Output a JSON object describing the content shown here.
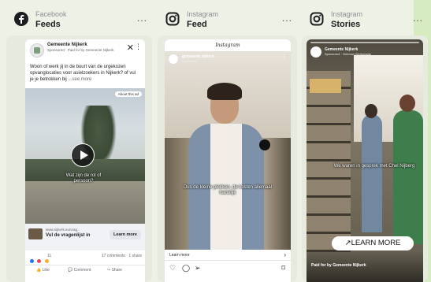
{
  "columns": [
    {
      "platform": "Facebook",
      "placement": "Feeds",
      "more": "...",
      "post": {
        "account": "Gemeente Nijkerk",
        "sponsored": "Sponsored · Paid for by Gemeente Nijkerk",
        "close": "✕",
        "menu": "⋮",
        "body": "Woon of werk jij in de buurt van de urgekozen opvanglocaties voor asielzoekers in Nijkerk? of vul je je betrokken bij",
        "see_more": "...see more",
        "about_ad": "About this ad",
        "video_caption": "Wat zijn de rol of persoon?",
        "link_url": "www.nijkerk.eu/vrag...",
        "link_title": "Vul de vragenlijst in",
        "cta": "Learn more",
        "reaction_count": "11",
        "comments_shares": "17 comments · 1 share",
        "actions": [
          "Like",
          "Comment",
          "Share"
        ]
      }
    },
    {
      "platform": "Instagram",
      "placement": "Feed",
      "more": "...",
      "post": {
        "top_logo": "Instagram",
        "account": "gemeente.nijkerk",
        "sponsored": "Sponsored",
        "menu": "⋮",
        "video_caption": "Dus de kleine plekken, de kosten allemaal hartelijk",
        "cta": "Learn more",
        "chevron": "›"
      }
    },
    {
      "platform": "Instagram",
      "placement": "Stories",
      "more": "...",
      "post": {
        "account": "Gemeente Nijkerk",
        "sponsored": "Sponsored · Gebouw Werkplaats",
        "video_caption": "We waren in gesprek met Chel Nijberg",
        "cta": "↗LEARN MORE",
        "paid_for": "Paid for by Gemeente Nijkerk"
      }
    }
  ],
  "colors": {
    "background": "#eef2e6",
    "facebook_blue": "#1877f2",
    "instagram": "#222222"
  }
}
